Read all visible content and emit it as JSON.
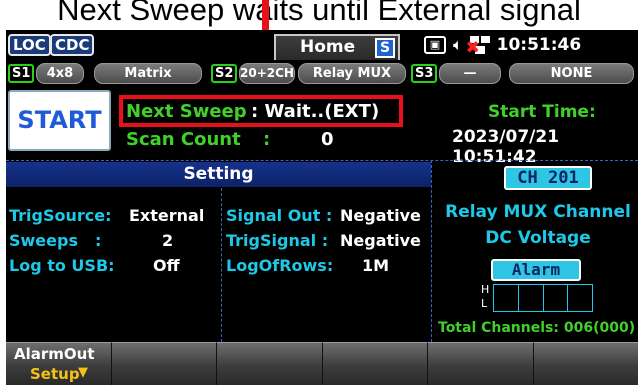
{
  "caption": "Next Sweep waits until External signal",
  "titlebar": {
    "tags": [
      "LOC",
      "CDC"
    ],
    "home_tab": "Home",
    "home_badge": "S",
    "usb_icon": "usb-drive-icon",
    "clock": "10:51:46"
  },
  "slots": {
    "s1": {
      "badge": "S1",
      "config": "4x8",
      "type": "Matrix"
    },
    "s2": {
      "badge": "S2",
      "config": "20+2CH",
      "type": "Relay MUX"
    },
    "s3": {
      "badge": "S3",
      "config": "—",
      "type": "NONE"
    }
  },
  "scan": {
    "start_label": "START",
    "next_sweep_label": "Next Sweep",
    "next_sweep_value": ": Wait..(EXT)",
    "scan_count_label": "Scan Count",
    "scan_count_sep": ":",
    "scan_count_value": "0",
    "start_time_label": "Start Time:",
    "start_time_value": "2023/07/21 10:51:42"
  },
  "setting": {
    "header": "Setting",
    "left": [
      {
        "label": "TrigSource:",
        "value": "External"
      },
      {
        "label": "Sweeps",
        "sep": ":",
        "value": "2"
      },
      {
        "label": "Log to USB:",
        "value": "Off"
      }
    ],
    "middle": [
      {
        "label": "Signal Out :",
        "value": "Negative"
      },
      {
        "label": "TrigSignal :",
        "value": "Negative"
      },
      {
        "label": "LogOfRows:",
        "value": "1M"
      }
    ]
  },
  "channel": {
    "badge": "CH 201",
    "type_line1": "Relay MUX Channel",
    "type_line2": "DC Voltage",
    "alarm": "Alarm",
    "alarm_high": "H",
    "alarm_low": "L",
    "total": "Total Channels: 006(000)"
  },
  "softkeys": [
    {
      "line1": "AlarmOut",
      "line2": "Setup"
    },
    {
      "line1": "",
      "line2": ""
    },
    {
      "line1": "",
      "line2": ""
    },
    {
      "line1": "",
      "line2": ""
    },
    {
      "line1": "",
      "line2": ""
    },
    {
      "line1": "",
      "line2": ""
    }
  ],
  "colors": {
    "accent_green": "#41d02a",
    "accent_cyan": "#1ec8e6",
    "highlight_red": "#e8101a",
    "softkey_yellow": "#f2c21b"
  }
}
